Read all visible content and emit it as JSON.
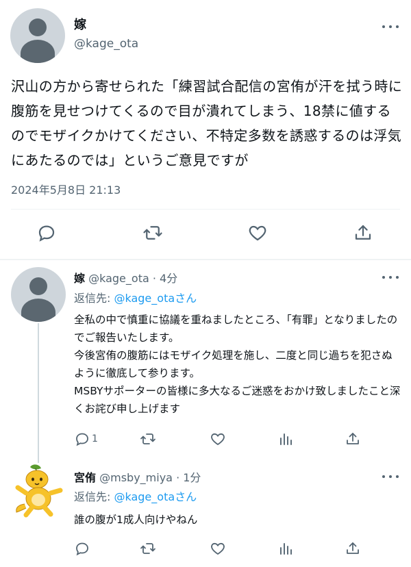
{
  "main_tweet": {
    "display_name": "嫁",
    "handle": "@kage_ota",
    "text": "沢山の方から寄せられた「練習試合配信の宮侑が汗を拭う時に腹筋を見せつけてくるので目が潰れてしまう、18禁に値するのでモザイクかけてください、不特定多数を誘惑するのは浮気にあたるのでは」というご意見ですが",
    "timestamp": "2024年5月8日 21:13"
  },
  "replies": [
    {
      "display_name": "嫁",
      "handle": "@kage_ota",
      "dot": "·",
      "time": "4分",
      "reply_to_label": "返信先: ",
      "reply_to_handle": "@kage_otaさん",
      "text": "全私の中で慎重に協議を重ねましたところ、「有罪」となりましたのでご報告いたします。\n今後宮侑の腹筋にはモザイク処理を施し、二度と同じ過ちを犯さぬように徹底して参ります。\nMSBYサポーターの皆様に多大なるご迷惑をおかけ致しましたこと深くお詫び申し上げます",
      "reply_count": "1"
    },
    {
      "display_name": "宮侑",
      "handle": "@msby_miya",
      "dot": "·",
      "time": "1分",
      "reply_to_label": "返信先: ",
      "reply_to_handle": "@kage_otaさん",
      "text": "誰の腹が1成人向けやねん"
    }
  ],
  "icons": {
    "more": "more-horizontal-icon",
    "reply": "reply-bubble-icon",
    "retweet": "retweet-icon",
    "like": "heart-icon",
    "views": "bar-chart-icon",
    "share": "share-upload-icon"
  },
  "colors": {
    "text": "#0f1419",
    "secondary": "#536471",
    "link": "#1d9bf0",
    "divider": "#eff3f4"
  }
}
